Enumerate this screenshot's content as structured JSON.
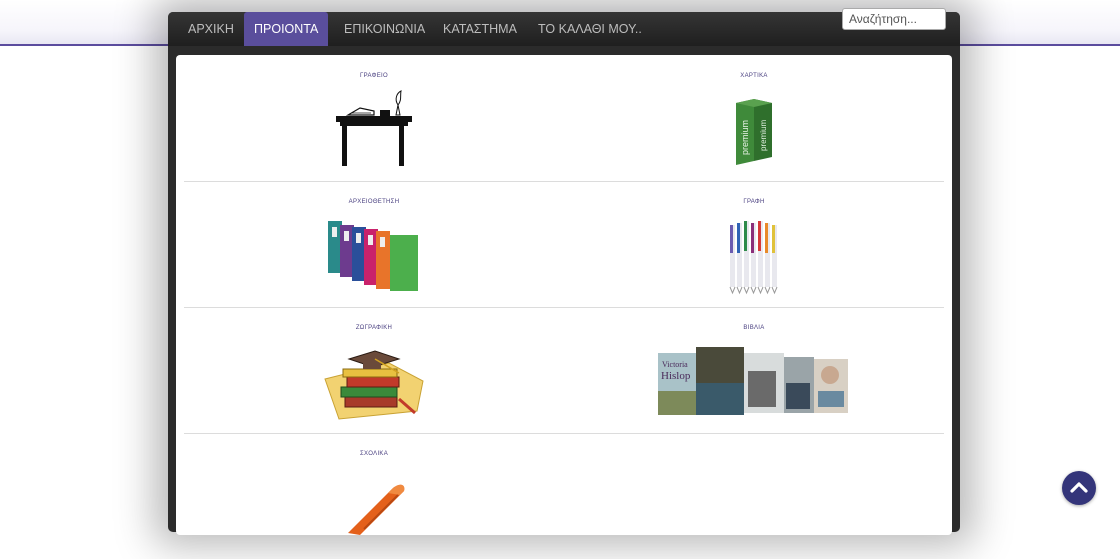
{
  "nav": {
    "items": [
      "ΑΡΧΙΚΗ",
      "ΠΡΟΙΟΝΤΑ",
      "ΕΠΙΚΟΙΝΩΝΙΑ",
      "ΚΑΤΑΣΤΗΜΑ",
      "ΤΟ ΚΑΛΑΘΙ ΜΟΥ.."
    ],
    "active": "ΠΡΟΙΟΝΤΑ"
  },
  "search": {
    "placeholder": "Αναζήτηση..."
  },
  "categories": [
    {
      "label": "ΓΡΑΦΕΙΟ",
      "icon": "desk-icon"
    },
    {
      "label": "ΧΑΡΤΙΚΑ",
      "icon": "paper-ream-icon"
    },
    {
      "label": "ΑΡΧΕΙΟΘΕΤΗΣΗ",
      "icon": "binders-icon"
    },
    {
      "label": "ΓΡΑΦΗ",
      "icon": "pens-icon"
    },
    {
      "label": "ΖΩΓΡΑΦΙΚΗ",
      "icon": "books-graduation-cap-icon"
    },
    {
      "label": "ΒΙΒΛΙΑ",
      "icon": "book-covers-icon"
    },
    {
      "label": "ΣΧΟΛΙΚΑ",
      "icon": "pen-icon"
    }
  ],
  "book_covers": {
    "hislop": [
      "Victoria",
      "Hislop"
    ]
  },
  "paper_brand": "premium",
  "scroll_top": {
    "icon": "chevron-up-icon"
  },
  "colors": {
    "nav_active": "#5a4e9c",
    "scroll_button": "#34357a",
    "header_line": "#5b4c9e"
  }
}
